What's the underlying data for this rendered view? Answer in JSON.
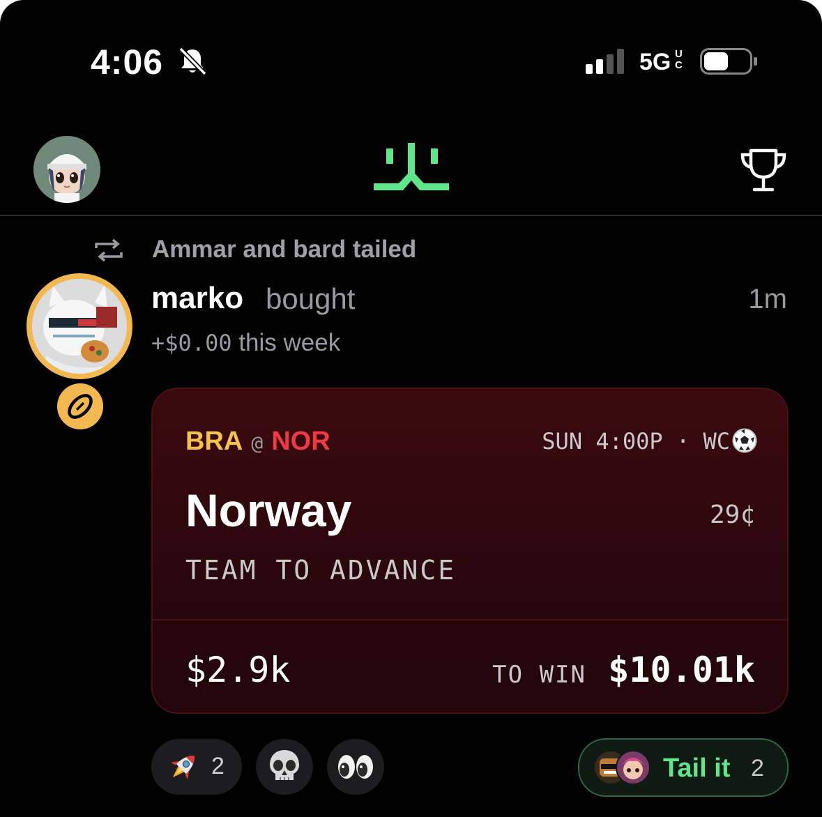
{
  "status_bar": {
    "time": "4:06",
    "network": "5G",
    "network_sub": "UC"
  },
  "header": {
    "logo_icon": "app-logo",
    "trophy_icon": "trophy-icon"
  },
  "post": {
    "social_context": "Ammar and bard tailed",
    "username": "marko",
    "action": "bought",
    "time_ago": "1m",
    "weekly_amount": "+$0.00",
    "weekly_suffix": "this week"
  },
  "bet_card": {
    "away_team": "BRA",
    "at": "@",
    "home_team": "NOR",
    "game_info": "SUN 4:00P · WC",
    "pick": "Norway",
    "price": "29¢",
    "market": "TEAM TO ADVANCE",
    "stake": "$2.9k",
    "to_win_label": "TO WIN",
    "to_win_value": "$10.01k"
  },
  "reactions": [
    {
      "emoji": "rocket",
      "count": "2"
    },
    {
      "emoji": "skull",
      "count": ""
    },
    {
      "emoji": "eyes",
      "count": ""
    }
  ],
  "tail_button": {
    "label": "Tail it",
    "count": "2"
  },
  "colors": {
    "accent_green": "#5fe68a",
    "away_team": "#f3c24a",
    "home_team": "#ef3a44",
    "badge_gold": "#f3b850"
  }
}
